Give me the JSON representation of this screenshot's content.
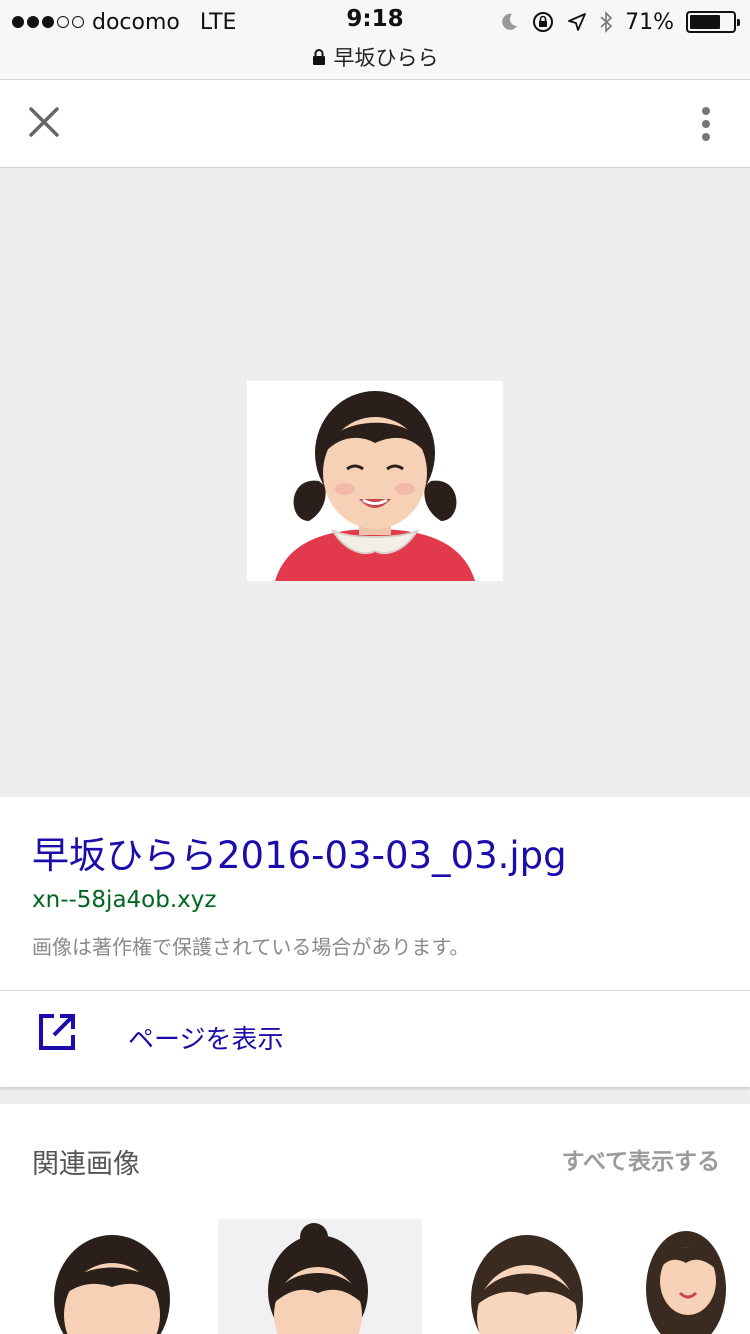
{
  "status_bar": {
    "carrier": "docomo",
    "network": "LTE",
    "time": "9:18",
    "battery_percent": "71%",
    "battery_level": 0.71,
    "url_title": "早坂ひらら"
  },
  "toolbar": {
    "close_icon": "close-icon",
    "more_icon": "more-vert-icon"
  },
  "image_info": {
    "title": "早坂ひらら2016-03-03_03.jpg",
    "domain": "xn--58ja4ob.xyz",
    "notice": "画像は著作権で保護されている場合があります。",
    "visit_label": "ページを表示"
  },
  "related": {
    "title": "関連画像",
    "view_all": "すべて表示する"
  },
  "colors": {
    "link": "#1a0dab",
    "domain": "#006621",
    "background": "#eeeeee"
  }
}
